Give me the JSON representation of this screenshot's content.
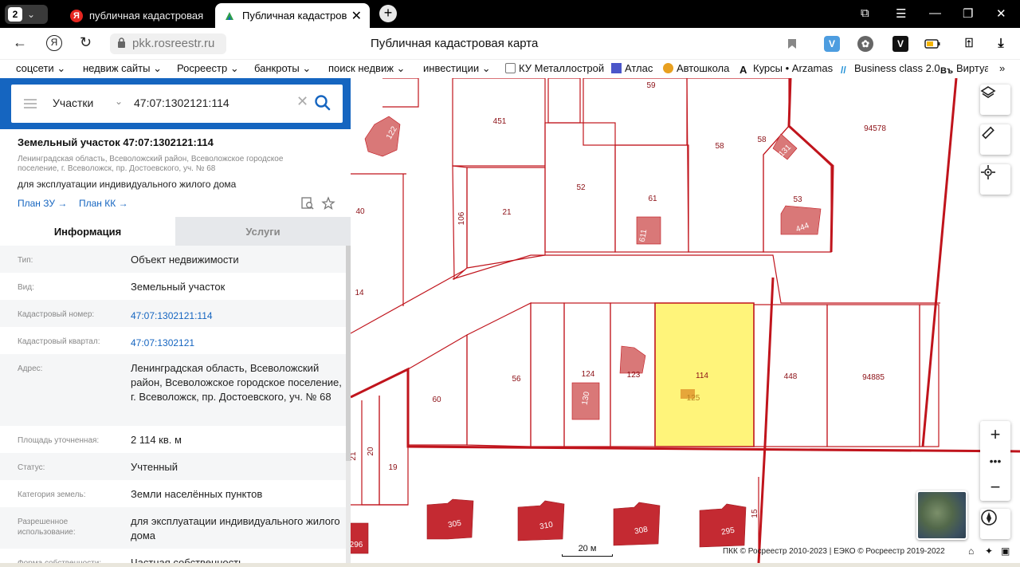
{
  "browser": {
    "tab_count": "2",
    "tabs": [
      {
        "label": "публичная кадастровая к",
        "favicon": "yandex-icon"
      },
      {
        "label": "Публичная кадастровая к",
        "favicon": "rosreestr-icon"
      }
    ],
    "url": "pkk.rosreestr.ru",
    "page_title": "Публичная кадастровая карта",
    "extensions": [
      "bookmark-icon",
      "v-extension-icon",
      "puzzle-icon",
      "v-dark-extension-icon",
      "battery-icon",
      "share-icon",
      "download-icon"
    ],
    "bookmarks": [
      {
        "label": "соцсети",
        "dropdown": true
      },
      {
        "label": "недвиж сайты",
        "dropdown": true
      },
      {
        "label": "Росреестр",
        "dropdown": true
      },
      {
        "label": "банкроты",
        "dropdown": true
      },
      {
        "label": "поиск недвиж",
        "dropdown": true
      },
      {
        "label": "инвестиции",
        "dropdown": true
      },
      {
        "label": "КУ Металлострой",
        "icon": "cube-icon"
      },
      {
        "label": "Атлас",
        "icon": "atlas-icon"
      },
      {
        "label": "Автошкола",
        "icon": "autoschool-icon"
      },
      {
        "label": "Курсы • Arzamas",
        "icon": "arzamas-icon"
      },
      {
        "label": "Business class 2.0",
        "icon": "business-icon"
      },
      {
        "label": "Виртуа",
        "icon": "virtual-icon"
      }
    ]
  },
  "search": {
    "type_label": "Участки",
    "query": "47:07:1302121:114"
  },
  "object": {
    "title": "Земельный участок 47:07:1302121:114",
    "address_short": "Ленинградская область, Всеволожский район, Всеволожское городское поселение, г. Всеволожск, пр. Достоевского, уч. № 68",
    "usage": "для эксплуатации индивидуального жилого дома",
    "links": [
      "План ЗУ →",
      "План КК →"
    ],
    "tabs": [
      "Информация",
      "Услуги"
    ],
    "rows": [
      {
        "key": "Тип:",
        "value": "Объект недвижимости"
      },
      {
        "key": "Вид:",
        "value": "Земельный участок"
      },
      {
        "key": "Кадастровый номер:",
        "value": "47:07:1302121:114",
        "link": true
      },
      {
        "key": "Кадастровый квартал:",
        "value": "47:07:1302121",
        "link": true
      },
      {
        "key": "Адрес:",
        "value": "Ленинградская область, Всеволожский район, Всеволожское городское поселение, г. Всеволожск, пр. Достоевского, уч. № 68"
      },
      {
        "key": "Площадь уточненная:",
        "value": "2 114 кв. м"
      },
      {
        "key": "Статус:",
        "value": "Учтенный"
      },
      {
        "key": "Категория земель:",
        "value": "Земли населённых пунктов"
      },
      {
        "key": "Разрешенное использование:",
        "value": "для эксплуатации индивидуального жилого дома"
      },
      {
        "key": "Форма собственности:",
        "value": "Частная собственность"
      }
    ]
  },
  "map": {
    "parcel_labels": [
      "59",
      "451",
      "58",
      "58",
      "94578",
      "122",
      "52",
      "61",
      "131",
      "53",
      "40",
      "106",
      "21",
      "611",
      "444",
      "14",
      "114",
      "448",
      "94885",
      "56",
      "124",
      "123",
      "60",
      "130",
      "125",
      "21",
      "20",
      "19",
      "305",
      "310",
      "308",
      "295",
      "296",
      "15"
    ],
    "scale": "20 м",
    "copyright": "ПКК © Росреестр 2010-2023 | ЕЭКО © Росреестр 2019-2022",
    "colors": {
      "boundary": "#c0141c",
      "selected": "#fff47a",
      "building": "#d97878",
      "building_dark": "#c42a32"
    }
  }
}
